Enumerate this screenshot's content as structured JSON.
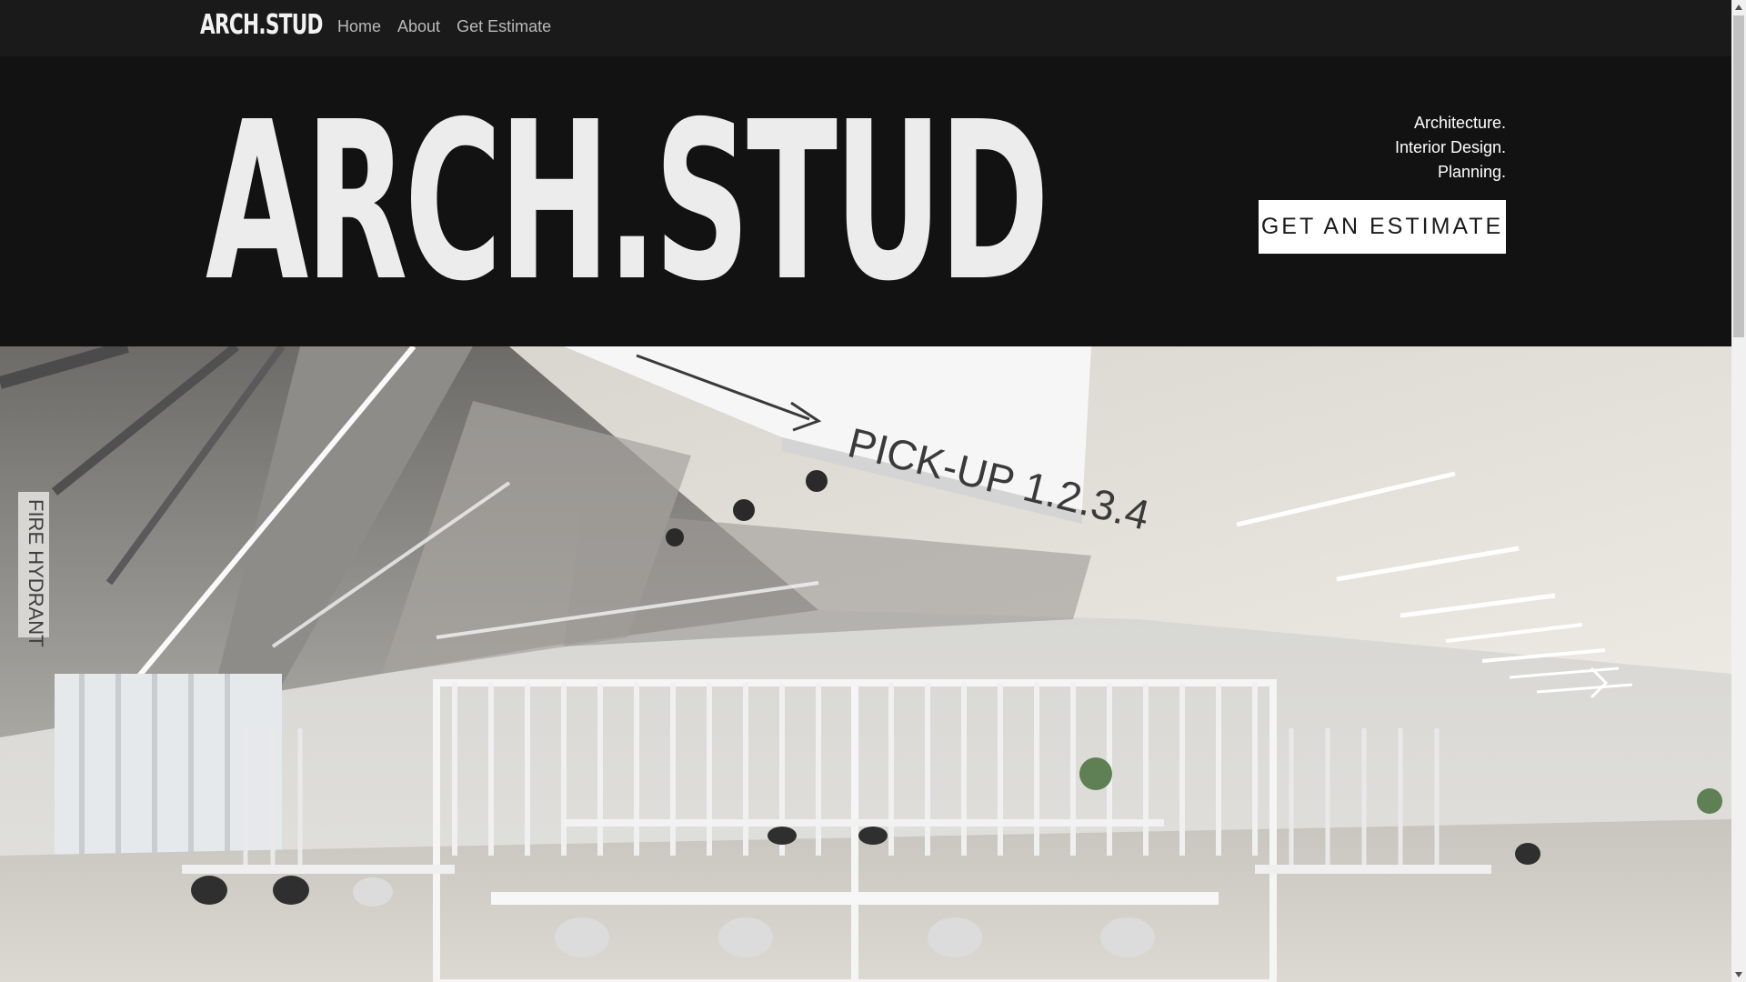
{
  "nav": {
    "brand": "ARCH.STUD",
    "links": [
      "Home",
      "About",
      "Get Estimate"
    ]
  },
  "hero": {
    "title": "ARCH.STUD",
    "tagline": [
      "Architecture.",
      "Interior Design.",
      "Planning."
    ],
    "cta_label": "GET AN ESTIMATE"
  },
  "photo": {
    "sign_main": "PICK-UP 1.2.3.4",
    "sign_side": "FIRE HYDRANT"
  },
  "icons": {
    "carousel_next": "chevron-right-icon",
    "scroll_up": "triangle-up-icon",
    "scroll_down": "triangle-down-icon"
  },
  "colors": {
    "header_bg": "#1a1a1a",
    "hero_bg": "#121212",
    "cta_bg": "#ffffff",
    "text_light": "#ececec"
  }
}
